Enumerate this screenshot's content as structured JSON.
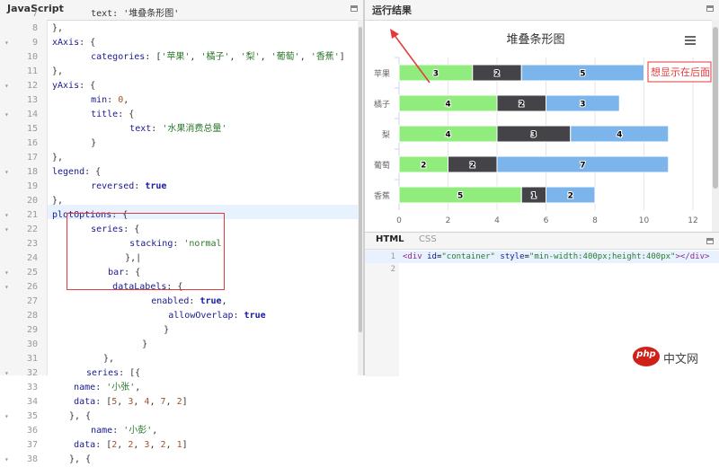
{
  "left_panel": {
    "title": "JavaScript",
    "lines": [
      {
        "n": "7",
        "fold": "",
        "html": "<span>    text: '堆叠条形图'</span>"
      },
      {
        "n": "8",
        "fold": "",
        "html": "},"
      },
      {
        "n": "9",
        "fold": "▾",
        "html": "<span class='k'>xAxis</span>: {"
      },
      {
        "n": "10",
        "fold": "",
        "html": "    <span class='k'>categories</span>: [<span class='s'>'苹果'</span>, <span class='s'>'橘子'</span>, <span class='s'>'梨'</span>, <span class='s'>'葡萄'</span>, <span class='s'>'香蕉'</span>]"
      },
      {
        "n": "11",
        "fold": "",
        "html": "},"
      },
      {
        "n": "12",
        "fold": "▾",
        "html": "<span class='k'>yAxis</span>: {"
      },
      {
        "n": "13",
        "fold": "",
        "html": "    <span class='k'>min</span>: <span class='n'>0</span>,"
      },
      {
        "n": "14",
        "fold": "▾",
        "html": "    <span class='k'>title</span>: {"
      },
      {
        "n": "15",
        "fold": "",
        "html": "        <span class='k'>text</span>: <span class='s'>'水果消费总量'</span>"
      },
      {
        "n": "16",
        "fold": "",
        "html": "    }"
      },
      {
        "n": "17",
        "fold": "",
        "html": "},"
      },
      {
        "n": "18",
        "fold": "▾",
        "html": "<span class='k'>legend</span>: {"
      },
      {
        "n": "19",
        "fold": "",
        "html": "    <span class='k'>reversed</span>: <span class='b'>true</span>"
      },
      {
        "n": "20",
        "fold": "",
        "html": "},"
      },
      {
        "n": "21",
        "fold": "▾",
        "html": "<span class='k'>plotOptions</span>: {"
      },
      {
        "n": "22",
        "fold": "▾",
        "html": "    <span class='k'>series</span>: {"
      },
      {
        "n": "23",
        "fold": "",
        "html": "        <span class='k'>stacking</span>: <span class='s'>'normal'</span>"
      },
      {
        "n": "24",
        "fold": "",
        "html": "    },|"
      },
      {
        "n": "25",
        "fold": "▾",
        "html": "    <span class='k'>bar</span>: {"
      },
      {
        "n": "26",
        "fold": "▾",
        "html": "        <span class='k'>dataLabels</span>: {"
      },
      {
        "n": "27",
        "fold": "",
        "html": "            <span class='k'>enabled</span>: <span class='b'>true</span>,"
      },
      {
        "n": "28",
        "fold": "",
        "html": "            <span class='k'>allowOverlap</span>: <span class='b'>true</span>"
      },
      {
        "n": "29",
        "fold": "",
        "html": "        }"
      },
      {
        "n": "30",
        "fold": "",
        "html": "    }"
      },
      {
        "n": "31",
        "fold": "",
        "html": "},"
      },
      {
        "n": "32",
        "fold": "▾",
        "html": "<span class='k'>series</span>: [{"
      },
      {
        "n": "33",
        "fold": "",
        "html": "    <span class='k'>name</span>: <span class='s'>'小张'</span>,"
      },
      {
        "n": "34",
        "fold": "",
        "html": "    <span class='k'>data</span>: [<span class='n'>5</span>, <span class='n'>3</span>, <span class='n'>4</span>, <span class='n'>7</span>, <span class='n'>2</span>]"
      },
      {
        "n": "35",
        "fold": "▾",
        "html": "}, {"
      },
      {
        "n": "36",
        "fold": "",
        "html": "    <span class='k'>name</span>: <span class='s'>'小彭'</span>,"
      },
      {
        "n": "37",
        "fold": "",
        "html": "    <span class='k'>data</span>: [<span class='n'>2</span>, <span class='n'>2</span>, <span class='n'>3</span>, <span class='n'>2</span>, <span class='n'>1</span>]"
      },
      {
        "n": "38",
        "fold": "▾",
        "html": "}, {"
      }
    ]
  },
  "right_panel": {
    "title": "运行结果",
    "annotation_text": "想显示在后面",
    "chart_data": {
      "type": "bar",
      "orientation": "horizontal",
      "stacking": "normal",
      "title": "堆叠条形图",
      "categories": [
        "苹果",
        "橘子",
        "梨",
        "葡萄",
        "香蕉"
      ],
      "series": [
        {
          "values": [
            5,
            3,
            4,
            7,
            2
          ],
          "color": "#7cb5ec"
        },
        {
          "values": [
            2,
            2,
            3,
            2,
            1
          ],
          "color": "#434348"
        },
        {
          "values": [
            3,
            4,
            4,
            2,
            5
          ],
          "color": "#90ed7d"
        }
      ],
      "x_ticks": [
        0,
        2,
        4,
        6,
        8,
        10,
        12
      ],
      "xlim": [
        0,
        13
      ],
      "grid": true
    }
  },
  "bottom_panel": {
    "tabs": [
      "HTML",
      "CSS"
    ],
    "lines": [
      {
        "n": "1",
        "html": "<span class='tag'>&lt;div</span> <span class='attr'>id</span>=<span class='val'>\"container\"</span> <span class='attr'>style</span>=<span class='val'>\"min-width:400px;height:400px\"</span><span class='tag'>&gt;&lt;/div&gt;</span>"
      },
      {
        "n": "2",
        "html": ""
      }
    ]
  },
  "watermark": {
    "logo": "php",
    "text": "中文网"
  }
}
